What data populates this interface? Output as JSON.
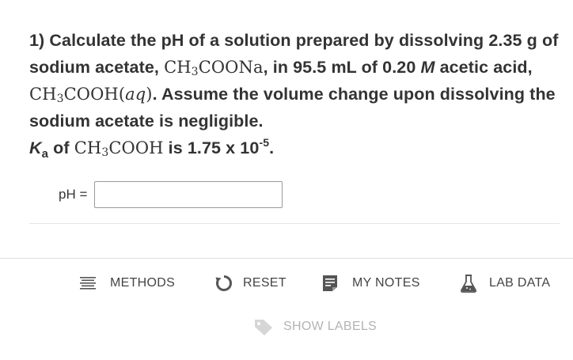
{
  "question": {
    "number": "1)",
    "text_a": "Calculate the pH of a solution prepared by dissolving 2.35 g of sodium acetate,",
    "formula_sodium_acetate_pre": "CH",
    "formula_sodium_acetate_sub": "3",
    "formula_sodium_acetate_post": "COONa",
    "text_b": ", in 95.5 mL of 0.20",
    "molarity_symbol": "M",
    "text_c": "acetic acid,",
    "formula_acetic_acid_pre": "CH",
    "formula_acetic_acid_sub": "3",
    "formula_acetic_acid_post": "COOH(",
    "formula_acetic_acid_phase": "aq",
    "formula_acetic_acid_close": ")",
    "text_d": ". Assume the volume change upon dissolving the sodium acetate is negligible.",
    "ka_symbol": "K",
    "ka_subscript": "a",
    "text_e": "of",
    "formula_ka_pre": "CH",
    "formula_ka_sub": "3",
    "formula_ka_post": "COOH",
    "text_f": "is 1.75 x 10",
    "ka_exponent": "-5",
    "text_g": "."
  },
  "answer": {
    "label": "pH =",
    "value": "",
    "placeholder": ""
  },
  "toolbar": {
    "methods_label": "METHODS",
    "reset_label": "RESET",
    "notes_label": "MY NOTES",
    "lab_data_label": "LAB DATA",
    "show_labels_label": "SHOW LABELS"
  },
  "icons": {
    "methods": "list-lines-icon",
    "reset": "circular-arrow-icon",
    "notes": "notepad-icon",
    "lab_data": "flask-icon",
    "show_labels": "tag-icon"
  },
  "colors": {
    "text": "#333333",
    "toolbar_text": "#444444",
    "disabled_text": "#b3b3b3",
    "icon_dark": "#555555",
    "icon_disabled": "#cccccc"
  }
}
